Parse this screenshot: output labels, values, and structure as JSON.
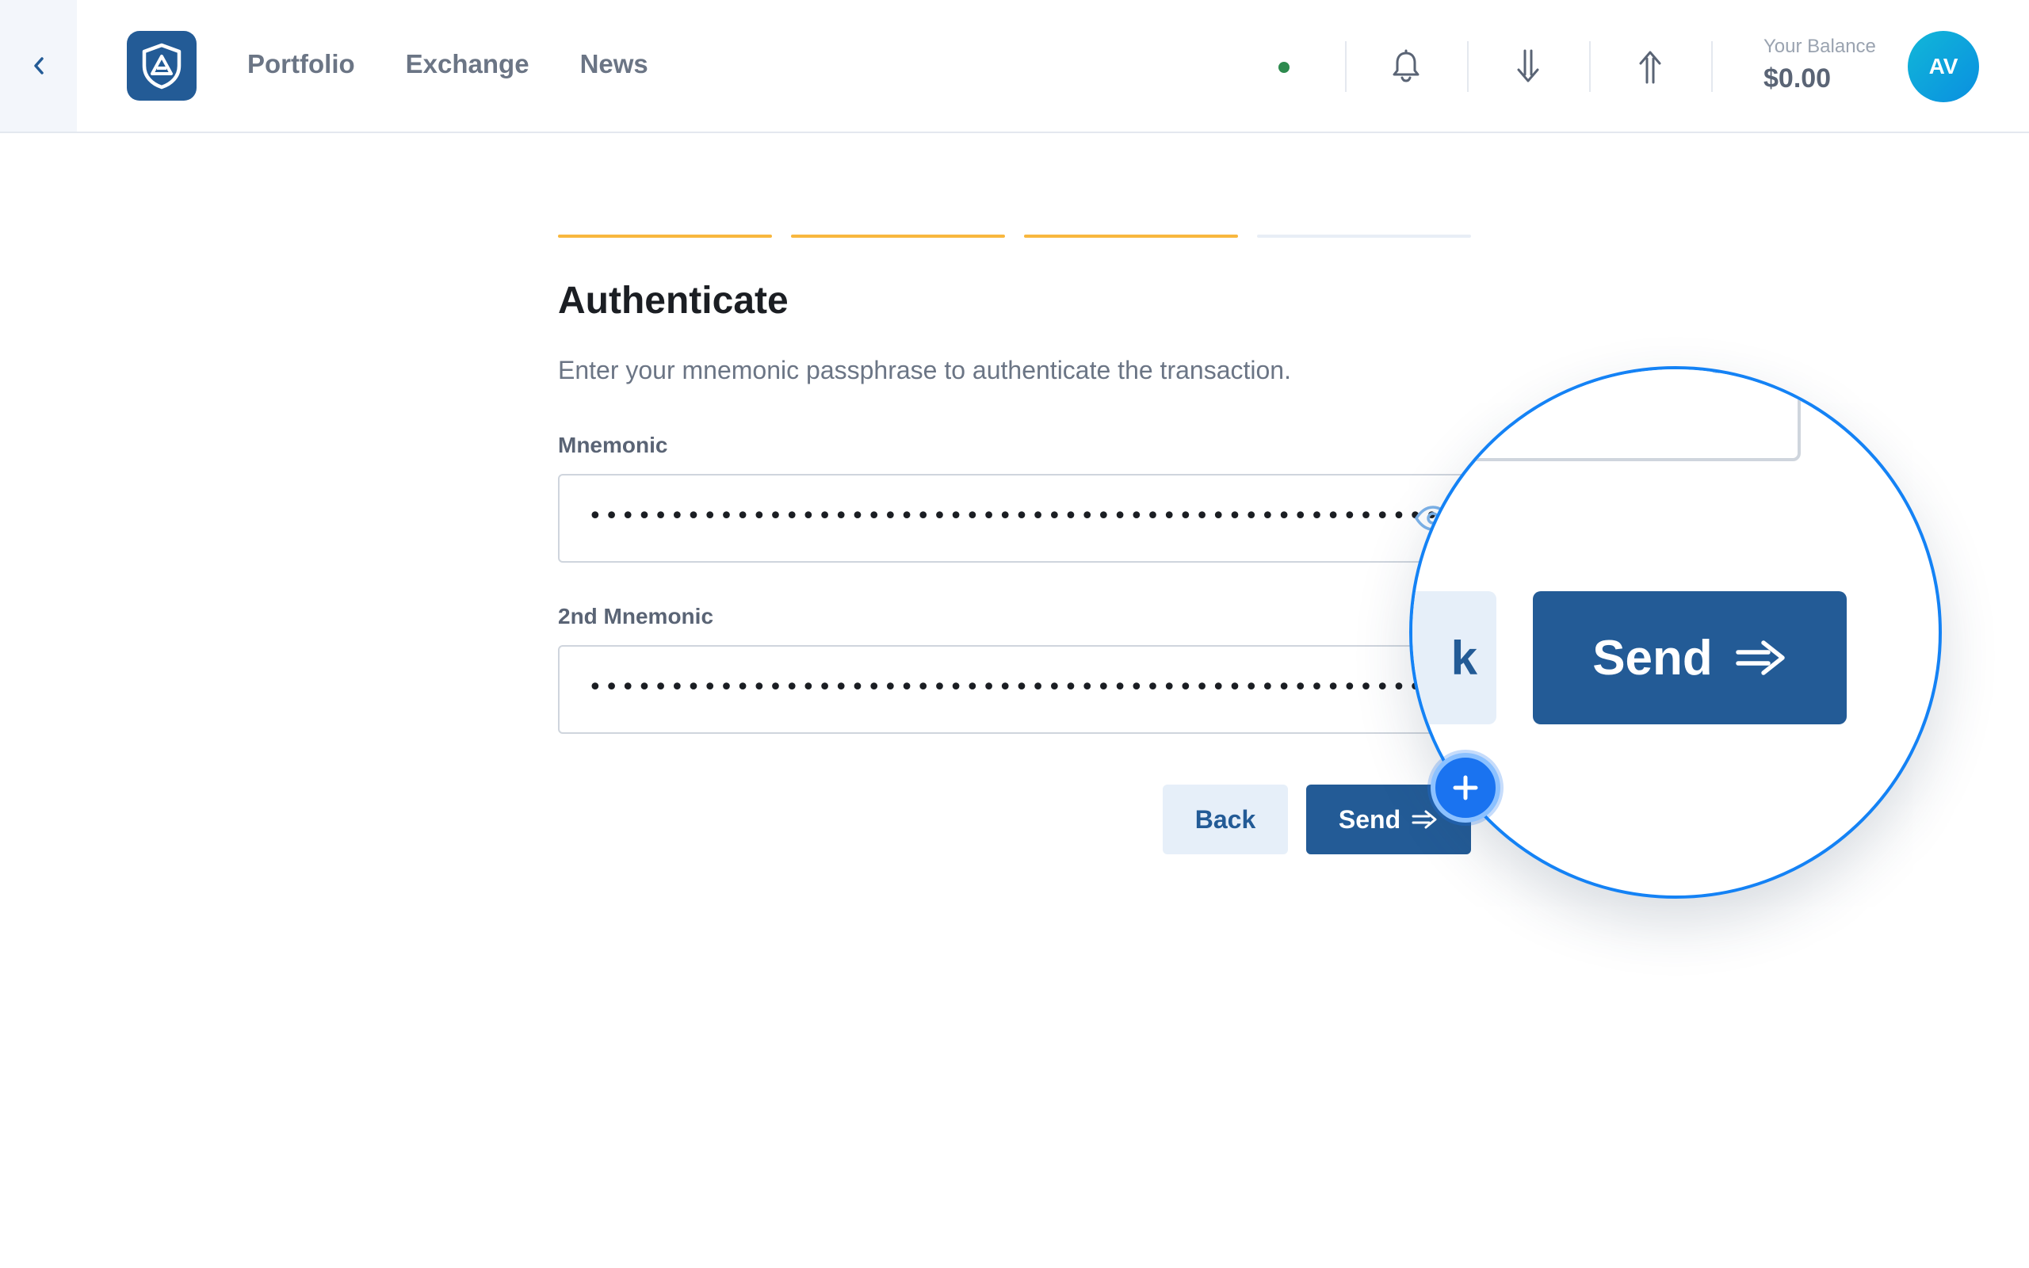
{
  "header": {
    "nav": [
      "Portfolio",
      "Exchange",
      "News"
    ],
    "balance_label": "Your Balance",
    "balance_value": "$0.00",
    "avatar_initials": "AV",
    "icons": {
      "back": "chevron-left-icon",
      "logo": "shield-logo-icon",
      "notifications": "bell-icon",
      "receive": "arrow-down-icon",
      "send": "arrow-up-icon"
    },
    "status_color": "#2d8a4e"
  },
  "steps": {
    "total": 4,
    "completed": 3,
    "active_color": "#f8b73e",
    "inactive_color": "#e8eef6"
  },
  "form": {
    "title": "Authenticate",
    "description": "Enter your mnemonic passphrase to authenticate the transaction.",
    "mnemonic_label": "Mnemonic",
    "mnemonic_value": "••••••••••••••••••••••••••••••••••••••••••••••••••••••••••",
    "second_mnemonic_label": "2nd Mnemonic",
    "second_mnemonic_value": "••••••••••••••••••••••••••••••••••••••••••••••••••••••••••",
    "back_label": "Back",
    "send_label": "Send"
  },
  "magnifier": {
    "dots": "•••••••",
    "back_fragment": "k",
    "send_label": "Send"
  },
  "colors": {
    "primary": "#235b96",
    "accent": "#1482f5",
    "secondary_bg": "#e6eff9"
  }
}
